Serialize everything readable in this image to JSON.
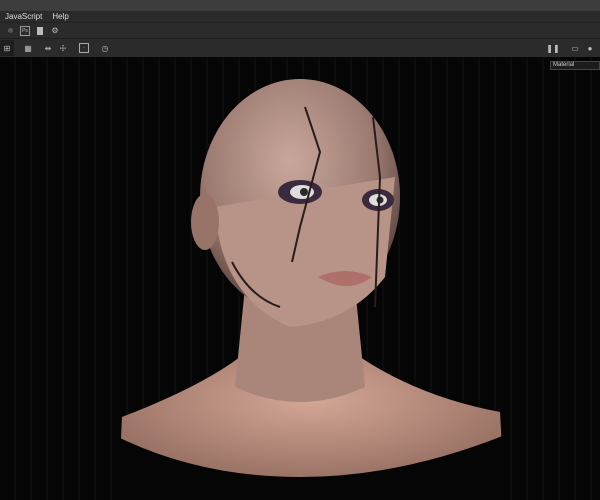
{
  "menu": {
    "items": [
      "JavaScript",
      "Help"
    ]
  },
  "toolbar1": {
    "icons": [
      "record-icon",
      "photoshop-icon",
      "document-icon",
      "settings-icon"
    ]
  },
  "toolbar2": {
    "icons": [
      "frame-icon",
      "grid-icon",
      "mirror-icon",
      "pose-icon",
      "add-frame-icon",
      "history-icon"
    ]
  },
  "viewport": {
    "render_mode": "Material"
  }
}
